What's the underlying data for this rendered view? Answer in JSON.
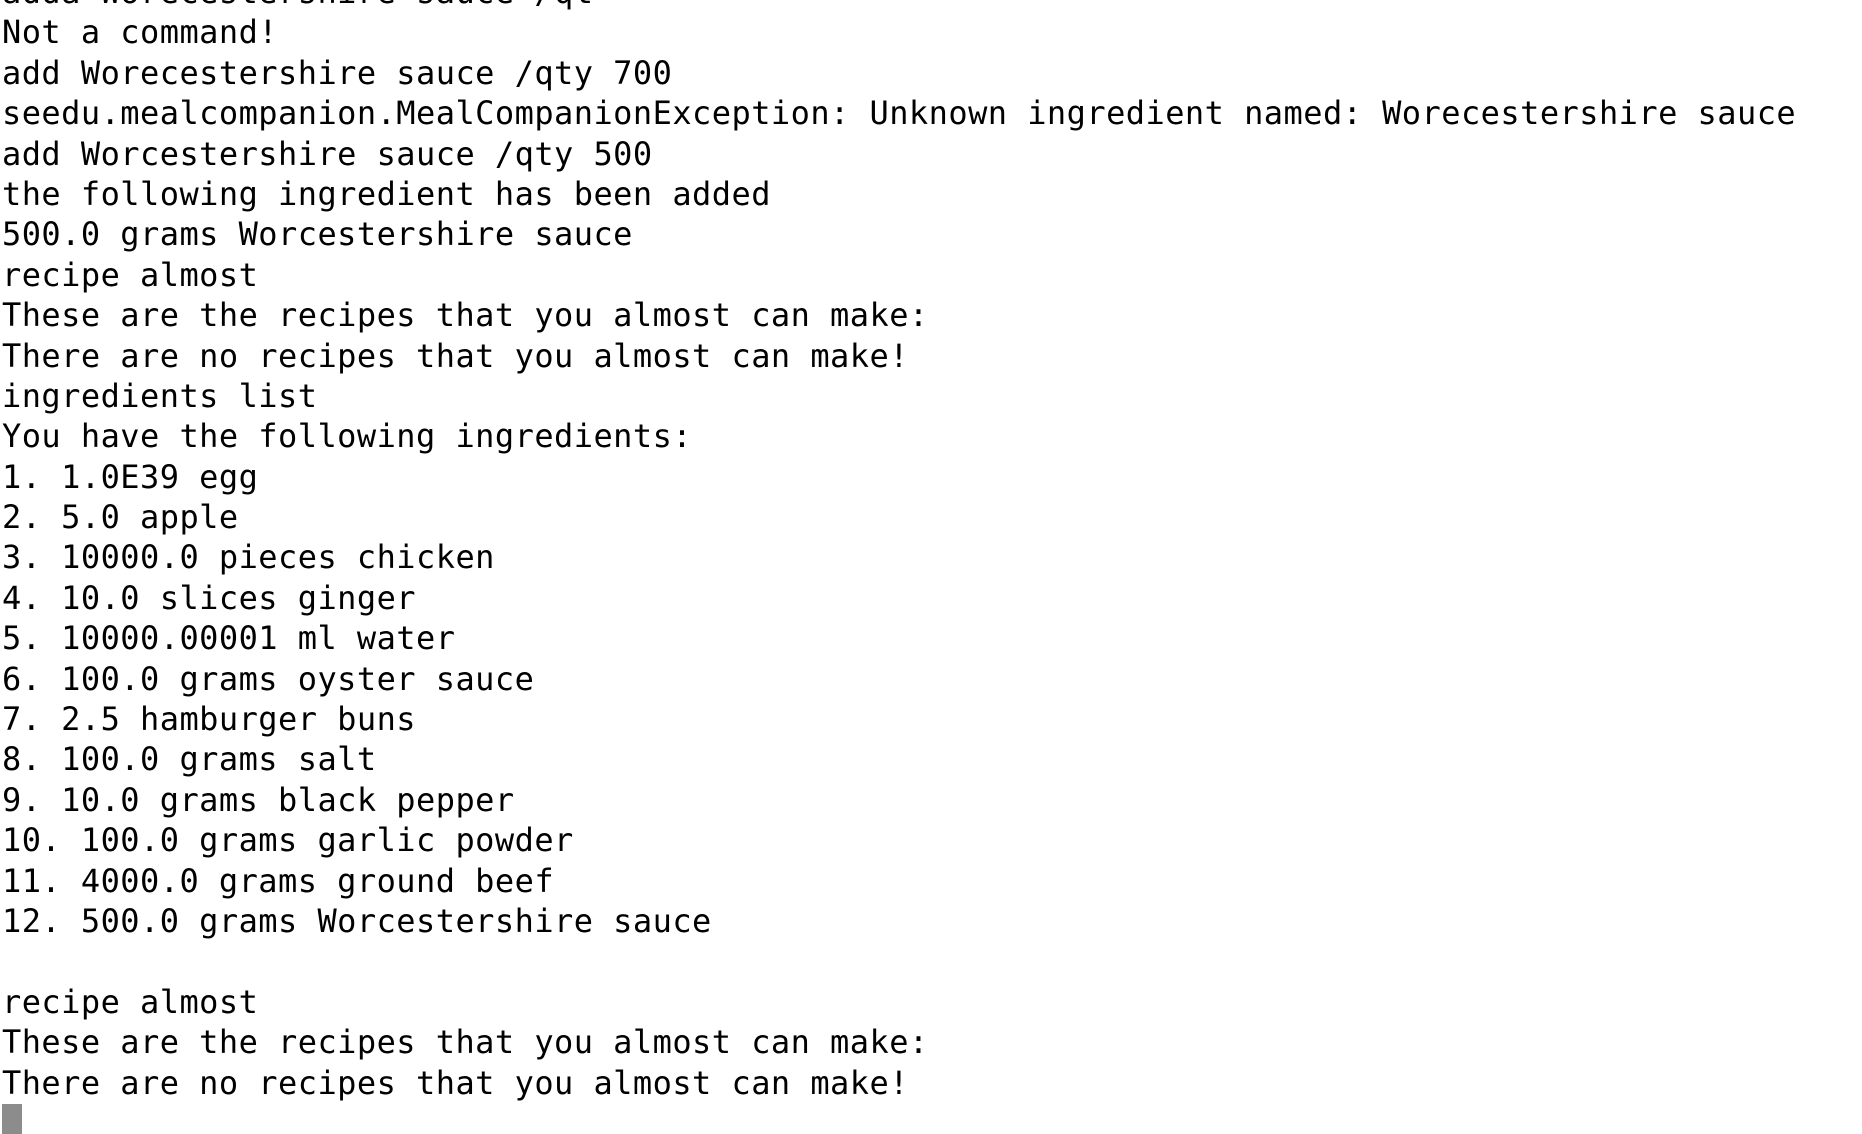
{
  "terminal": {
    "lines": [
      "adda Worecestershire sauce /qt",
      "Not a command!",
      "add Worecestershire sauce /qty 700",
      "seedu.mealcompanion.MealCompanionException: Unknown ingredient named: Worecestershire sauce",
      "add Worcestershire sauce /qty 500",
      "the following ingredient has been added",
      "500.0 grams Worcestershire sauce",
      "recipe almost",
      "These are the recipes that you almost can make:",
      "There are no recipes that you almost can make!",
      "ingredients list",
      "You have the following ingredients:",
      "1. 1.0E39 egg",
      "2. 5.0 apple",
      "3. 10000.0 pieces chicken",
      "4. 10.0 slices ginger",
      "5. 10000.00001 ml water",
      "6. 100.0 grams oyster sauce",
      "7. 2.5 hamburger buns",
      "8. 100.0 grams salt",
      "9. 10.0 grams black pepper",
      "10. 100.0 grams garlic powder",
      "11. 4000.0 grams ground beef",
      "12. 500.0 grams Worcestershire sauce",
      "",
      "recipe almost",
      "These are the recipes that you almost can make:",
      "There are no recipes that you almost can make!"
    ],
    "cursor_color": "#8c8c8c",
    "background_color": "#ffffff",
    "text_color": "#000000"
  }
}
